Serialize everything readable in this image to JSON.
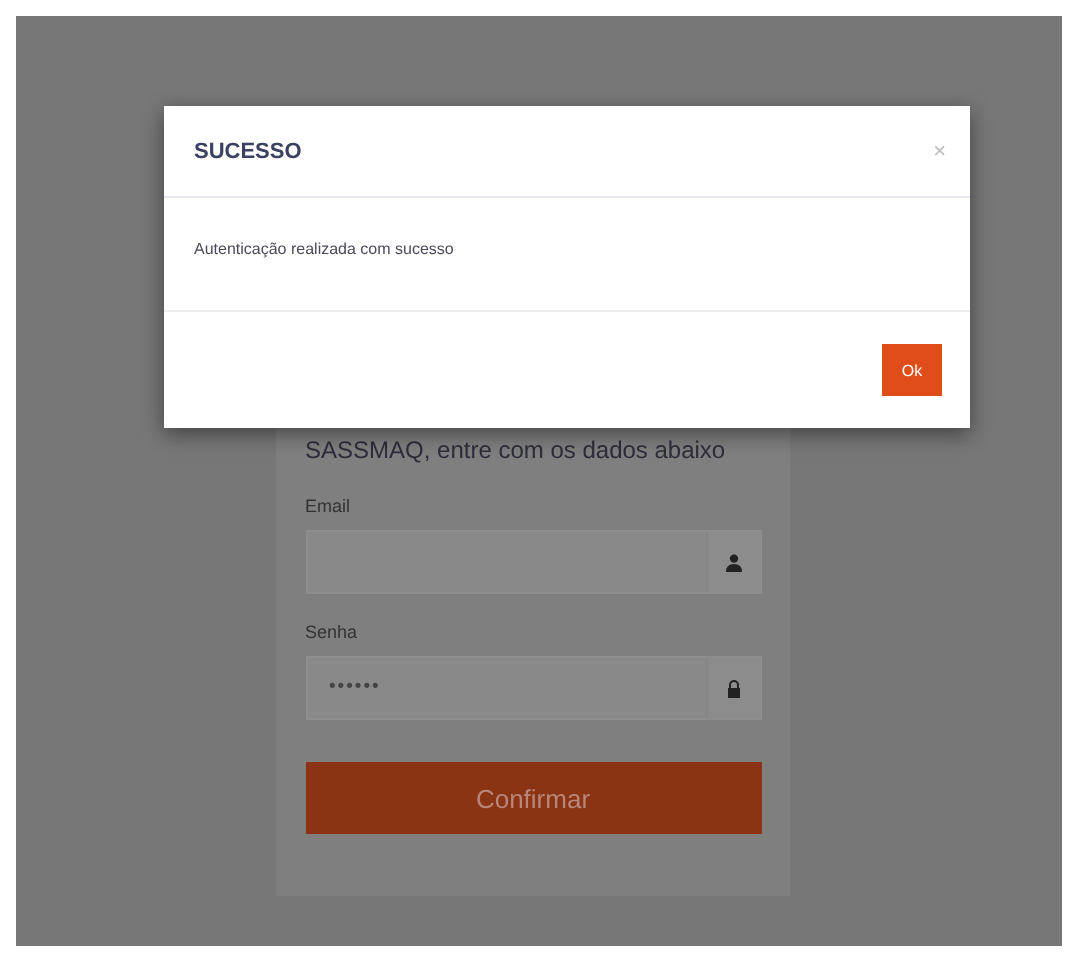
{
  "login": {
    "tagline": "SASSMAQ, entre com os dados abaixo",
    "fields": [
      {
        "label": "Email",
        "kind": "user"
      },
      {
        "label": "Senha",
        "value": "••••••",
        "kind": "lock"
      }
    ],
    "submit": "Confirmar"
  },
  "modal": {
    "title": "SUCESSO",
    "close": "×",
    "message": "Autenticação realizada com sucesso",
    "button": "Ok"
  }
}
